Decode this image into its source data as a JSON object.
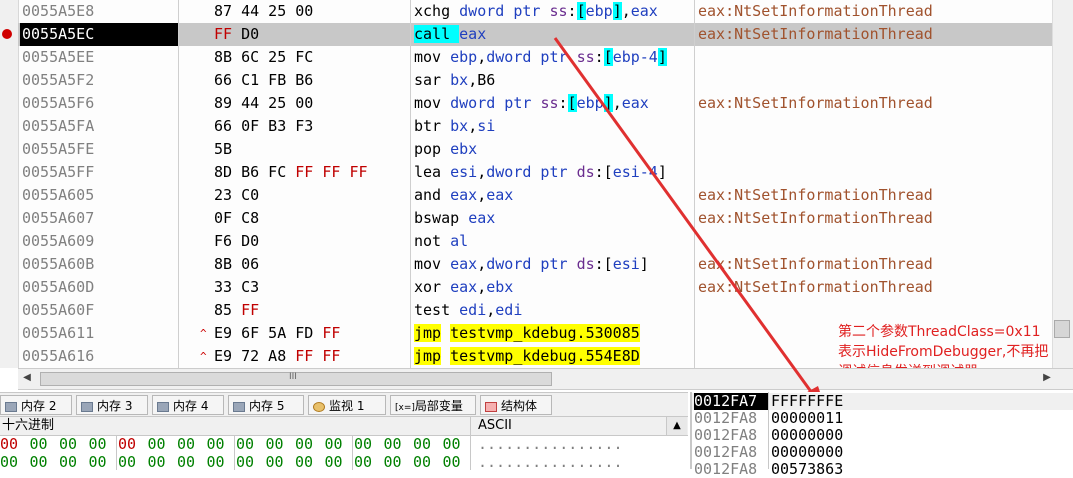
{
  "disasm": {
    "rows": [
      {
        "addr": "0055A5E8",
        "bytes": "87 44 25 00",
        "ins": [
          [
            "kw",
            "xchg "
          ],
          [
            "reg",
            "dword ptr "
          ],
          [
            "seg",
            "ss"
          ],
          [
            "kw",
            ":"
          ],
          [
            "hl-cyan",
            "["
          ],
          [
            "reg",
            "ebp"
          ],
          [
            "hl-cyan",
            "]"
          ],
          [
            "kw",
            ","
          ],
          [
            "reg",
            "eax"
          ]
        ],
        "cmt": "eax:NtSetInformationThread"
      },
      {
        "addr": "0055A5EC",
        "bytes": "FF D0",
        "ins": [
          [
            "hl-cyan",
            "call "
          ],
          [
            "reg",
            "eax"
          ]
        ],
        "cmt": "eax:NtSetInformationThread",
        "sel": true,
        "bp": true
      },
      {
        "addr": "0055A5EE",
        "bytes": "8B 6C 25 FC",
        "ins": [
          [
            "kw",
            "mov "
          ],
          [
            "reg",
            "ebp"
          ],
          [
            "kw",
            ","
          ],
          [
            "reg",
            "dword ptr "
          ],
          [
            "seg",
            "ss"
          ],
          [
            "kw",
            ":"
          ],
          [
            "hl-cyan",
            "["
          ],
          [
            "reg",
            "ebp-4"
          ],
          [
            "hl-cyan",
            "]"
          ]
        ],
        "cmt": ""
      },
      {
        "addr": "0055A5F2",
        "bytes": "66 C1 FB B6",
        "ins": [
          [
            "kw",
            "sar "
          ],
          [
            "reg",
            "bx"
          ],
          [
            "kw",
            ","
          ],
          [
            "imm",
            "B6"
          ]
        ],
        "cmt": ""
      },
      {
        "addr": "0055A5F6",
        "bytes": "89 44 25 00",
        "ins": [
          [
            "kw",
            "mov "
          ],
          [
            "reg",
            "dword ptr "
          ],
          [
            "seg",
            "ss"
          ],
          [
            "kw",
            ":"
          ],
          [
            "hl-cyan",
            "["
          ],
          [
            "reg",
            "ebp"
          ],
          [
            "hl-cyan",
            "]"
          ],
          [
            "kw",
            ","
          ],
          [
            "reg",
            "eax"
          ]
        ],
        "cmt": "eax:NtSetInformationThread"
      },
      {
        "addr": "0055A5FA",
        "bytes": "66 0F B3 F3",
        "ins": [
          [
            "kw",
            "btr "
          ],
          [
            "reg",
            "bx"
          ],
          [
            "kw",
            ","
          ],
          [
            "reg",
            "si"
          ]
        ],
        "cmt": ""
      },
      {
        "addr": "0055A5FE",
        "bytes": "5B",
        "ins": [
          [
            "kw",
            "pop "
          ],
          [
            "reg",
            "ebx"
          ]
        ],
        "cmt": ""
      },
      {
        "addr": "0055A5FF",
        "bytes": "8D B6 FC FF FF FF",
        "ins": [
          [
            "kw",
            "lea "
          ],
          [
            "reg",
            "esi"
          ],
          [
            "kw",
            ","
          ],
          [
            "reg",
            "dword ptr "
          ],
          [
            "seg",
            "ds"
          ],
          [
            "kw",
            ":["
          ],
          [
            "reg",
            "esi-4"
          ],
          [
            "kw",
            "]"
          ]
        ],
        "cmt": ""
      },
      {
        "addr": "0055A605",
        "bytes": "23 C0",
        "ins": [
          [
            "kw",
            "and "
          ],
          [
            "reg",
            "eax"
          ],
          [
            "kw",
            ","
          ],
          [
            "reg",
            "eax"
          ]
        ],
        "cmt": "eax:NtSetInformationThread"
      },
      {
        "addr": "0055A607",
        "bytes": "0F C8",
        "ins": [
          [
            "kw",
            "bswap "
          ],
          [
            "reg",
            "eax"
          ]
        ],
        "cmt": "eax:NtSetInformationThread"
      },
      {
        "addr": "0055A609",
        "bytes": "F6 D0",
        "ins": [
          [
            "kw",
            "not "
          ],
          [
            "reg",
            "al"
          ]
        ],
        "cmt": ""
      },
      {
        "addr": "0055A60B",
        "bytes": "8B 06",
        "ins": [
          [
            "kw",
            "mov "
          ],
          [
            "reg",
            "eax"
          ],
          [
            "kw",
            ","
          ],
          [
            "reg",
            "dword ptr "
          ],
          [
            "seg",
            "ds"
          ],
          [
            "kw",
            ":["
          ],
          [
            "reg",
            "esi"
          ],
          [
            "kw",
            "]"
          ]
        ],
        "cmt": "eax:NtSetInformationThread"
      },
      {
        "addr": "0055A60D",
        "bytes": "33 C3",
        "ins": [
          [
            "kw",
            "xor "
          ],
          [
            "reg",
            "eax"
          ],
          [
            "kw",
            ","
          ],
          [
            "reg",
            "ebx"
          ]
        ],
        "cmt": "eax:NtSetInformationThread"
      },
      {
        "addr": "0055A60F",
        "bytes": "85 FF",
        "ins": [
          [
            "kw",
            "test "
          ],
          [
            "reg",
            "edi"
          ],
          [
            "kw",
            ","
          ],
          [
            "reg",
            "edi"
          ]
        ],
        "cmt": ""
      },
      {
        "addr": "0055A611",
        "bytes": "E9 6F 5A FD FF",
        "ins": [
          [
            "hl-yel",
            "jmp"
          ],
          [
            "kw",
            " "
          ],
          [
            "hl-yel",
            "testvmp_kdebug.530085"
          ]
        ],
        "cmt": "",
        "jmp": true
      },
      {
        "addr": "0055A616",
        "bytes": "E9 72 A8 FF FF",
        "ins": [
          [
            "hl-yel",
            "jmp"
          ],
          [
            "kw",
            " "
          ],
          [
            "hl-yel",
            "testvmp_kdebug.554E8D"
          ]
        ],
        "cmt": "",
        "jmp": true
      }
    ],
    "jump_marker": "^"
  },
  "annotation": {
    "line1": "第二个参数ThreadClass=0x11",
    "line2": "表示HideFromDebugger,不再把",
    "line3": "调试信息发送到调试器"
  },
  "hscroll": {
    "left_arrow": "◀",
    "right_arrow": "▶",
    "grip": "III"
  },
  "tabs": [
    {
      "label": "内存 2",
      "icon": "memory-icon"
    },
    {
      "label": "内存 3",
      "icon": "memory-icon"
    },
    {
      "label": "内存 4",
      "icon": "memory-icon"
    },
    {
      "label": "内存 5",
      "icon": "memory-icon"
    },
    {
      "label": "监视 1",
      "icon": "watch-icon"
    },
    {
      "label": "局部变量",
      "icon": "locals-icon",
      "prefix": "[x=]"
    },
    {
      "label": "结构体",
      "icon": "struct-icon"
    }
  ],
  "hex": {
    "header_hex": "十六进制",
    "header_ascii": "ASCII",
    "rows": [
      {
        "bytes": [
          "00",
          "00",
          "00",
          "00",
          "00",
          "00",
          "00",
          "00",
          "00",
          "00",
          "00",
          "00",
          "00",
          "00",
          "00",
          "00"
        ],
        "ascii": "................"
      },
      {
        "bytes": [
          "00",
          "00",
          "00",
          "00",
          "00",
          "00",
          "00",
          "00",
          "00",
          "00",
          "00",
          "00",
          "00",
          "00",
          "00",
          "00"
        ],
        "ascii": "................"
      }
    ]
  },
  "stack": {
    "rows": [
      {
        "addr": "0012FA7",
        "val": "FFFFFFFE",
        "sel": true
      },
      {
        "addr": "0012FA8",
        "val": "00000011"
      },
      {
        "addr": "0012FA8",
        "val": "00000000"
      },
      {
        "addr": "0012FA8",
        "val": "00000000"
      },
      {
        "addr": "0012FA8",
        "val": "00573863"
      }
    ]
  },
  "colors": {
    "highlight_cyan": "#00ffff",
    "highlight_yellow": "#ffff00",
    "comment": "#a0522d",
    "annotation": "#e02020",
    "breakpoint": "#d00000"
  }
}
